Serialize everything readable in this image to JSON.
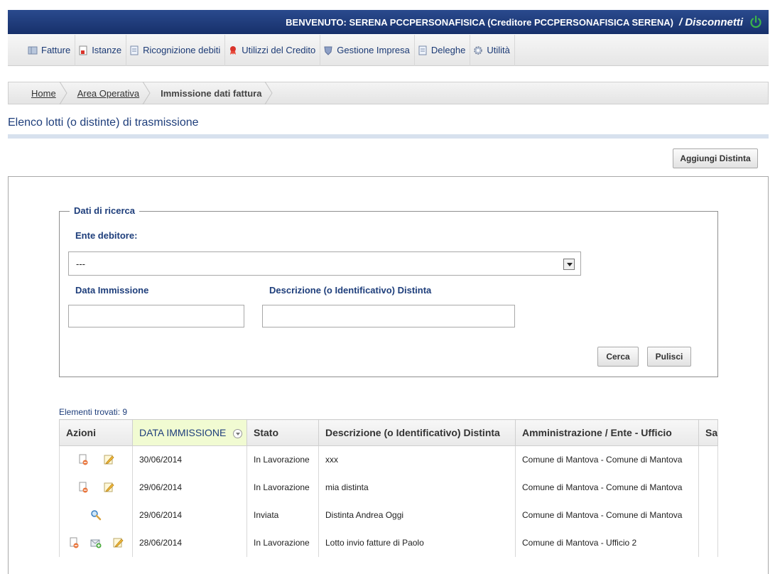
{
  "header": {
    "welcome": "BENVENUTO: SERENA PCCPERSONAFISICA (Creditore PCCPERSONAFISICA SERENA)",
    "logout": "/ Disconnetti",
    "accent": "#1e3a78",
    "power_icon_color": "#3bb54a"
  },
  "menu": {
    "items": [
      {
        "label": "Fatture",
        "icon": "invoices-icon"
      },
      {
        "label": "Istanze",
        "icon": "document-icon"
      },
      {
        "label": "Ricognizione debiti",
        "icon": "page-icon"
      },
      {
        "label": "Utilizzi del Credito",
        "icon": "ribbon-icon"
      },
      {
        "label": "Gestione Impresa",
        "icon": "shield-icon"
      },
      {
        "label": "Deleghe",
        "icon": "page-icon"
      },
      {
        "label": "Utilità",
        "icon": "gear-icon"
      }
    ]
  },
  "breadcrumb": [
    "Home",
    "Area Operativa",
    "Immissione dati fattura"
  ],
  "page": {
    "title": "Elenco lotti (o distinte) di trasmissione",
    "add_button": "Aggiungi Distinta"
  },
  "search": {
    "legend": "Dati di ricerca",
    "ente_label": "Ente debitore:",
    "ente_value": "---",
    "data_label": "Data Immissione",
    "data_value": "",
    "desc_label": "Descrizione (o Identificativo) Distinta",
    "desc_value": "",
    "cerca": "Cerca",
    "pulisci": "Pulisci"
  },
  "results": {
    "found": "Elementi trovati: 9",
    "columns": [
      "Azioni",
      "DATA IMMISSIONE",
      "Stato",
      "Descrizione (o Identificativo) Distinta",
      "Amministrazione / Ente - Ufficio",
      "Sa"
    ],
    "rows": [
      {
        "actions": [
          "delete-icon",
          "edit-icon"
        ],
        "date": "30/06/2014",
        "state": "In Lavorazione",
        "desc": "xxx",
        "admin": "Comune di Mantova - Comune di Mantova"
      },
      {
        "actions": [
          "delete-icon",
          "edit-icon"
        ],
        "date": "29/06/2014",
        "state": "In Lavorazione",
        "desc": "mia distinta",
        "admin": "Comune di Mantova - Comune di Mantova"
      },
      {
        "actions": [
          "view-icon"
        ],
        "date": "29/06/2014",
        "state": "Inviata",
        "desc": "Distinta Andrea Oggi",
        "admin": "Comune di Mantova - Comune di Mantova"
      },
      {
        "actions": [
          "delete-icon",
          "send-icon",
          "edit-icon"
        ],
        "date": "28/06/2014",
        "state": "In Lavorazione",
        "desc": "Lotto invio fatture di Paolo",
        "admin": "Comune di Mantova - Ufficio 2"
      }
    ]
  }
}
